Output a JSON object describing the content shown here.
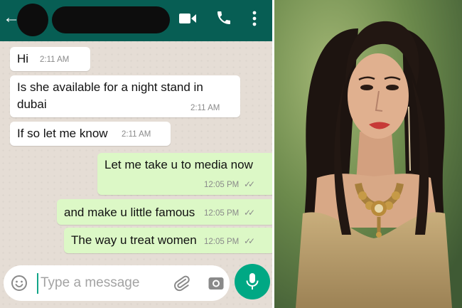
{
  "header": {
    "back_icon": "arrow-left-icon",
    "contact_name_redacted": true,
    "icons": [
      "video-call-icon",
      "phone-icon",
      "more-vert-icon"
    ]
  },
  "messages": [
    {
      "direction": "incoming",
      "text": "Hi",
      "time": "2:11 AM"
    },
    {
      "direction": "incoming",
      "text": "Is she available for a night stand in",
      "text_line2": "dubai",
      "time": "2:11 AM"
    },
    {
      "direction": "incoming",
      "text": "If so let me know",
      "time": "2:11 AM"
    },
    {
      "direction": "outgoing",
      "text": "Let me take u to media now",
      "time": "12:05 PM",
      "status": "double-tick-icon"
    },
    {
      "direction": "outgoing",
      "text": "and make u little famous",
      "time": "12:05 PM",
      "status": "double-tick-icon"
    },
    {
      "direction": "outgoing",
      "text": "The way u treat women",
      "time": "12:05 PM",
      "status": "double-tick-icon"
    }
  ],
  "composer": {
    "placeholder": "Type a message",
    "value": "",
    "icons": [
      "emoji-icon",
      "attachment-icon",
      "camera-icon",
      "mic-icon"
    ]
  },
  "colors": {
    "header": "#075e54",
    "chat_background": "#e5ddd5",
    "incoming_bubble": "#ffffff",
    "outgoing_bubble": "#dcf8c6",
    "accent": "#00a884"
  }
}
